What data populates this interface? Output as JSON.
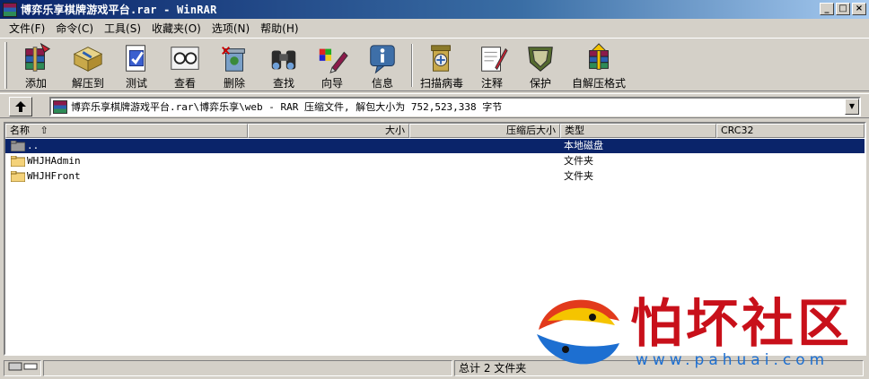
{
  "window": {
    "title": "博弈乐享棋牌游戏平台.rar - WinRAR",
    "controls": [
      "_",
      "□",
      "×"
    ]
  },
  "menu": [
    "文件(F)",
    "命令(C)",
    "工具(S)",
    "收藏夹(O)",
    "选项(N)",
    "帮助(H)"
  ],
  "toolbar": {
    "buttons": [
      {
        "label": "添加",
        "icon": "add-archive-icon"
      },
      {
        "label": "解压到",
        "icon": "extract-to-icon"
      },
      {
        "label": "测试",
        "icon": "test-icon"
      },
      {
        "label": "查看",
        "icon": "view-icon"
      },
      {
        "label": "删除",
        "icon": "delete-icon"
      },
      {
        "label": "查找",
        "icon": "find-binoculars-icon"
      },
      {
        "label": "向导",
        "icon": "wizard-icon"
      },
      {
        "label": "信息",
        "icon": "info-icon"
      },
      {
        "label": "扫描病毒",
        "icon": "virus-scan-icon"
      },
      {
        "label": "注释",
        "icon": "comment-icon"
      },
      {
        "label": "保护",
        "icon": "protect-shield-icon"
      },
      {
        "label": "自解压格式",
        "icon": "sfx-icon"
      }
    ]
  },
  "address": {
    "path": "博弈乐享棋牌游戏平台.rar\\博弈乐享\\web - RAR 压缩文件, 解包大小为 752,523,338 字节",
    "up_icon": "up-folder-icon"
  },
  "columns": [
    "名称",
    "大小",
    "压缩后大小",
    "类型",
    "CRC32"
  ],
  "files": [
    {
      "name": "..",
      "type": "本地磁盘",
      "selected": true
    },
    {
      "name": "WHJHAdmin",
      "type": "文件夹",
      "selected": false
    },
    {
      "name": "WHJHFront",
      "type": "文件夹",
      "selected": false
    }
  ],
  "status": {
    "summary": "总计 2 文件夹"
  },
  "watermark": {
    "title": "怕坏社区",
    "url": "www.pahuai.com"
  },
  "colors": {
    "titlebar": "#0a246a",
    "selection": "#0a246a",
    "watermark_red": "#c8101a",
    "watermark_blue": "#1d6fd1"
  }
}
